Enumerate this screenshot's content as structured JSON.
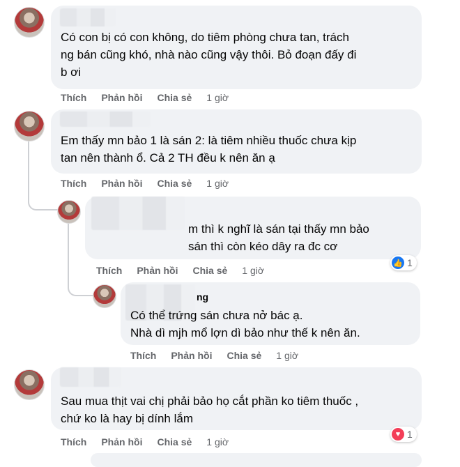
{
  "actions": {
    "like": "Thích",
    "reply": "Phản hồi",
    "share": "Chia sẻ"
  },
  "comments": [
    {
      "text": "Có con bị có con không, do tiêm phòng chưa tan, trách\nng bán cũng khó, nhà nào cũng vậy thôi. Bỏ đoạn đấy đi\nb ơi",
      "time": "1 giờ"
    },
    {
      "text": "Em thấy mn bảo 1 là sán 2: là tiêm nhiều thuốc chưa kịp\ntan nên thành ổ. Cả 2 TH đều k nên ăn ạ",
      "time": "1 giờ"
    },
    {
      "text": "m thì k nghĩ là sán tại thấy mn bảo\nsán thì còn kéo dây ra đc cơ",
      "time": "1 giờ",
      "reaction": {
        "icon": "like-icon",
        "count": "1",
        "color": "#1877f2"
      }
    },
    {
      "name_fragment": "ng",
      "text": "Có thể trứng sán chưa nở bác ạ.\nNhà dì mjh mổ lợn dì bảo như thế k nên ăn.",
      "time": "1 giờ"
    },
    {
      "text": "Sau mua thịt vai chị phải bảo họ cắt phần ko tiêm thuốc ,\nchứ ko là hay bị dính lắm",
      "time": "1 giờ",
      "reaction": {
        "icon": "heart-icon",
        "count": "1",
        "color": "#f33e58"
      }
    }
  ]
}
